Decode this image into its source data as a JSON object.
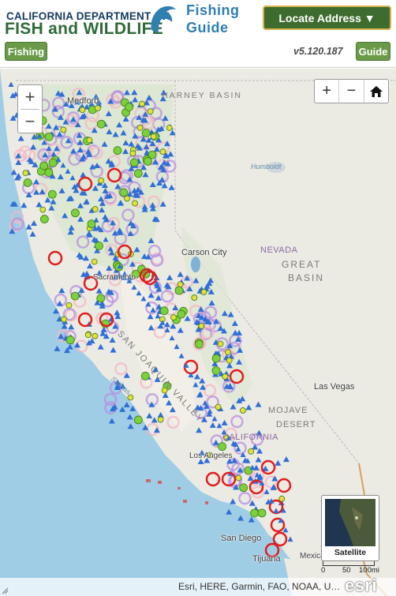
{
  "header": {
    "brand_line1": "CALIFORNIA DEPARTMENT OF",
    "brand_line2": "FISH and WILDLIFE",
    "app_title_line1": "Fishing",
    "app_title_line2": "Guide",
    "locate_button": "Locate Address ▼",
    "fishing_button": "Fishing",
    "version": "v5.120.187",
    "guide_button": "Guide"
  },
  "map_controls": {
    "zoom_in": "+",
    "zoom_out": "−",
    "nav_zoom_in": "+",
    "nav_zoom_out": "−",
    "home_icon": "home-icon"
  },
  "map_labels": {
    "regions": [
      "HARNEY BASIN",
      "GREAT",
      "BASIN",
      "MOJAVE",
      "DESERT",
      "SAN JOAQUIN VALLEY"
    ],
    "states": [
      "NEVADA",
      "CALIFORNIA"
    ],
    "cities": [
      "Medford",
      "Carson City",
      "Sacramento",
      "Las Vegas",
      "Los Angeles",
      "San Diego",
      "Tijuana",
      "Mexicali"
    ],
    "water": [
      "Humboldt",
      "Salinas"
    ]
  },
  "basemap": {
    "label": "Satellite"
  },
  "scale": {
    "labels": [
      "0",
      "50",
      "100mi"
    ]
  },
  "attribution": {
    "text": "Esri, HERE, Garmin, FAO, NOAA, U…",
    "logo": "esri"
  },
  "colors": {
    "ocean": "#9fcde5",
    "land": "#ebeae3",
    "lake_marker": "#2f6fd6",
    "green_marker": "#7ad13a",
    "yellow_marker": "#e4e03a",
    "red_ring": "#e01e1e",
    "pink_ring": "#f3b8c4",
    "purple_ring": "#b78fe0",
    "header_green_button": "#6a9a48",
    "locate_button": "#3e6b2e"
  }
}
